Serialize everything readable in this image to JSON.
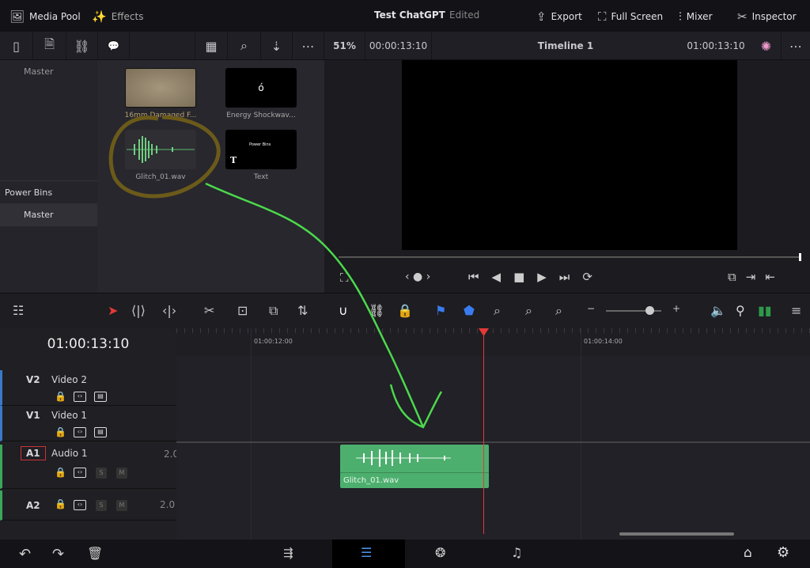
{
  "topbar": {
    "media_pool": "Media Pool",
    "effects": "Effects",
    "project": "Test ChatGPT",
    "status": "Edited",
    "export": "Export",
    "full_screen": "Full Screen",
    "mixer": "Mixer",
    "inspector": "Inspector"
  },
  "toolbar": {
    "zoom": "51%",
    "source_timecode": "00:00:13:10",
    "timeline_name": "Timeline 1",
    "record_timecode": "01:00:13:10"
  },
  "sidebar": {
    "master": "Master",
    "power_bins": "Power Bins",
    "power_master": "Master"
  },
  "media": [
    {
      "name": "16mm Damaged F..."
    },
    {
      "name": "Energy Shockwav..."
    },
    {
      "name": "Glitch_01.wav"
    },
    {
      "name": "Text",
      "thumb_title": "Power Bins"
    }
  ],
  "timeline": {
    "timecode": "01:00:13:10",
    "ruler": [
      "01:00:12:00",
      "01:00:14:00"
    ],
    "tracks": [
      {
        "id": "V2",
        "name": "Video 2"
      },
      {
        "id": "V1",
        "name": "Video 1"
      },
      {
        "id": "A1",
        "name": "Audio 1",
        "channels": "2.0"
      },
      {
        "id": "A2",
        "channels": "2.0"
      }
    ],
    "clip": {
      "name": "Glitch_01.wav",
      "color": "#4caf6e"
    }
  },
  "colors": {
    "playhead": "#e53935",
    "annotation_arrow": "#4cd94c",
    "annotation_circle": "#6b5a1a"
  }
}
